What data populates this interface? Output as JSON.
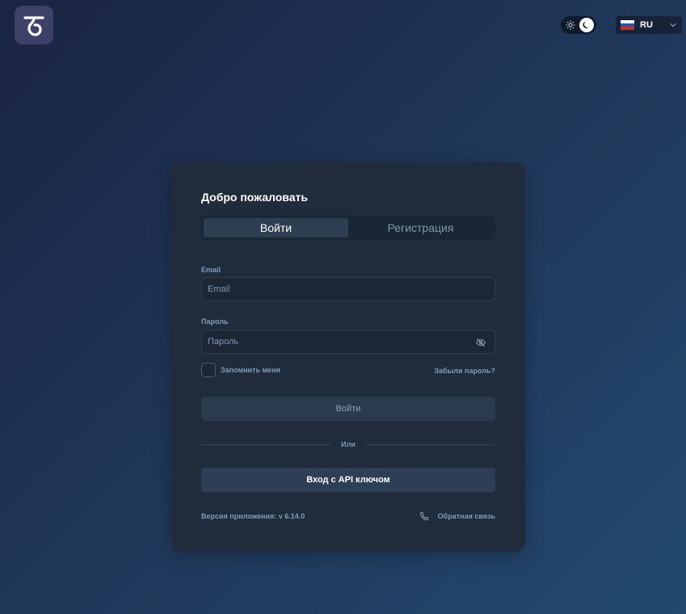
{
  "header": {
    "logo_icon": "brand-logo-icon",
    "theme_toggle": {
      "icons": [
        "sun-icon",
        "moon-icon"
      ],
      "mode": "dark"
    },
    "language": {
      "selected": "RU",
      "flag_icon": "russia-flag-icon",
      "flag_colors": [
        "#ffffff",
        "#1c57c7",
        "#d52b1e"
      ]
    }
  },
  "card": {
    "title": "Добро пожаловать",
    "tabs": [
      {
        "label": "Войти",
        "active": true
      },
      {
        "label": "Регистрация",
        "active": false
      }
    ],
    "email": {
      "label": "Email",
      "placeholder": "Email",
      "value": ""
    },
    "password": {
      "label": "Пароль",
      "placeholder": "Пароль",
      "value": "",
      "toggle_icon": "eye-off-icon"
    },
    "remember_label": "Запомнить меня",
    "forgot_label": "Забыли пароль?",
    "login_button": "Войти",
    "divider_text": "Или",
    "api_button": "Вход с API ключом",
    "version_text": "Версия приложения: v 6.14.0",
    "feedback_label": "Обратная связь",
    "feedback_icon": "phone-icon"
  },
  "colors": {
    "card_bg": "#202c3b",
    "accent_text": "#7f9bb8",
    "logo_bg": "#3d4168"
  }
}
